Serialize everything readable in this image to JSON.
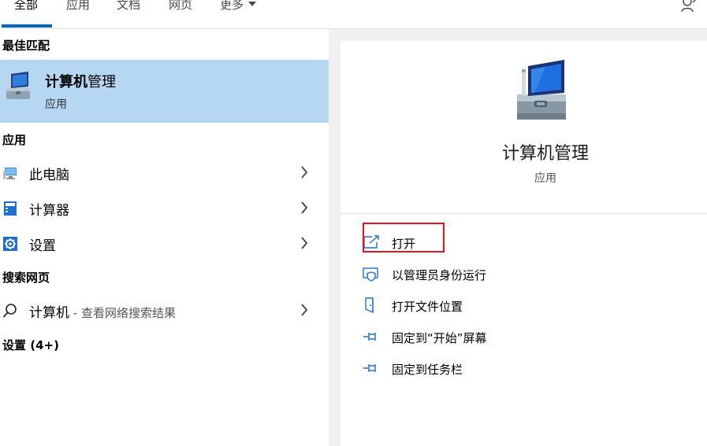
{
  "tabs": [
    {
      "label": "全部"
    },
    {
      "label": "应用"
    },
    {
      "label": "文档"
    },
    {
      "label": "网页"
    },
    {
      "label": "更多"
    }
  ],
  "sections": {
    "best_match": "最佳匹配",
    "apps": "应用",
    "web": "搜索网页",
    "settings": "设置 (4+)"
  },
  "best_match": {
    "title_bold": "计算机",
    "title_rest": "管理",
    "subtitle": "应用"
  },
  "apps": [
    {
      "label": "此电脑",
      "icon": "this-pc-icon"
    },
    {
      "label": "计算器",
      "icon": "calculator-icon"
    },
    {
      "label": "设置",
      "icon": "settings-gear-icon"
    }
  ],
  "web_result": {
    "label": "计算机",
    "suffix": " - 查看网络搜索结果",
    "icon": "search-icon"
  },
  "detail": {
    "title": "计算机管理",
    "subtitle": "应用",
    "actions": [
      {
        "label": "打开",
        "icon": "open-icon"
      },
      {
        "label": "以管理员身份运行",
        "icon": "shield-admin-icon"
      },
      {
        "label": "打开文件位置",
        "icon": "file-location-icon"
      },
      {
        "label": "固定到“开始”屏幕",
        "icon": "pin-icon"
      },
      {
        "label": "固定到任务栏",
        "icon": "pin-icon"
      }
    ]
  },
  "colors": {
    "accent": "#0067c0",
    "selected_bg": "#b5d7f2",
    "highlight_border": "#e81123",
    "icon_blue": "#1e6fcf"
  }
}
